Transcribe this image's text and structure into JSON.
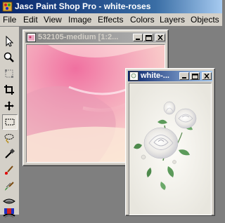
{
  "window": {
    "title": "Jasc Paint Shop Pro - white-roses"
  },
  "menu": [
    "File",
    "Edit",
    "View",
    "Image",
    "Effects",
    "Colors",
    "Layers",
    "Objects"
  ],
  "tools": [
    "arrow-tool",
    "zoom-tool",
    "deformation-tool",
    "crop-tool",
    "mover-tool",
    "selection-tool",
    "freehand-selection-tool",
    "dropper-tool",
    "paint-brush-tool",
    "clone-brush-tool",
    "color-replacer-tool",
    "retouch-tool",
    "picture-tube-tool"
  ],
  "documents": [
    {
      "title": "532105-medium [1:2...",
      "state": "inactive"
    },
    {
      "title": "white-...",
      "state": "active"
    }
  ],
  "colors": {
    "title_active": "#0a246a",
    "title_inactive": "#808080",
    "chrome": "#d4d0c8",
    "workspace": "#7f7f7f"
  }
}
